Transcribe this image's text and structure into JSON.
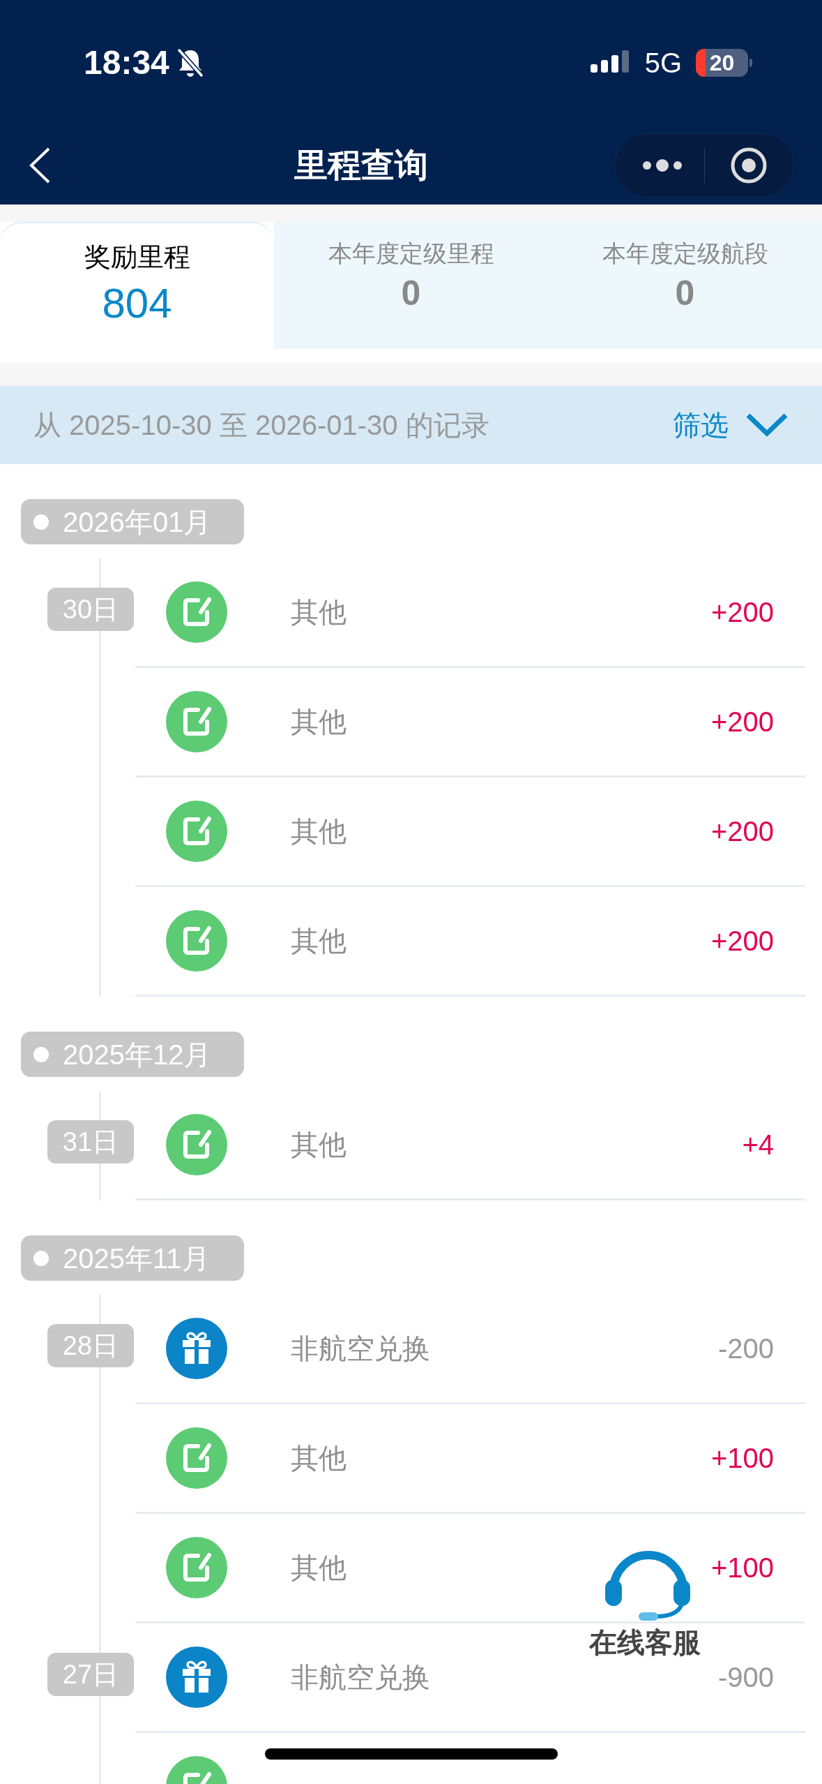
{
  "status_bar": {
    "time": "18:34",
    "network": "5G",
    "battery": "20"
  },
  "nav": {
    "title": "里程查询"
  },
  "tabs": [
    {
      "label": "奖励里程",
      "value": "804",
      "selected": true
    },
    {
      "label": "本年度定级里程",
      "value": "0",
      "selected": false
    },
    {
      "label": "本年度定级航段",
      "value": "0",
      "selected": false
    }
  ],
  "filter_bar": {
    "range": "从 2025-10-30 至 2026-01-30 的记录",
    "filter": "筛选"
  },
  "months": [
    {
      "month": "2026年01月",
      "entries": [
        {
          "day": "30日",
          "kind": "other",
          "label": "其他",
          "amount": "+200"
        },
        {
          "kind": "other",
          "label": "其他",
          "amount": "+200"
        },
        {
          "kind": "other",
          "label": "其他",
          "amount": "+200"
        },
        {
          "kind": "other",
          "label": "其他",
          "amount": "+200"
        }
      ]
    },
    {
      "month": "2025年12月",
      "entries": [
        {
          "day": "31日",
          "kind": "other",
          "label": "其他",
          "amount": "+4"
        }
      ]
    },
    {
      "month": "2025年11月",
      "entries": [
        {
          "day": "28日",
          "kind": "redeem",
          "label": "非航空兑换",
          "amount": "-200"
        },
        {
          "kind": "other",
          "label": "其他",
          "amount": "+100"
        },
        {
          "kind": "other",
          "label": "其他",
          "amount": "+100"
        },
        {
          "day": "27日",
          "kind": "redeem",
          "label": "非航空兑换",
          "amount": "-900"
        },
        {
          "kind": "other"
        }
      ]
    }
  ],
  "support": {
    "label": "在线客服"
  }
}
